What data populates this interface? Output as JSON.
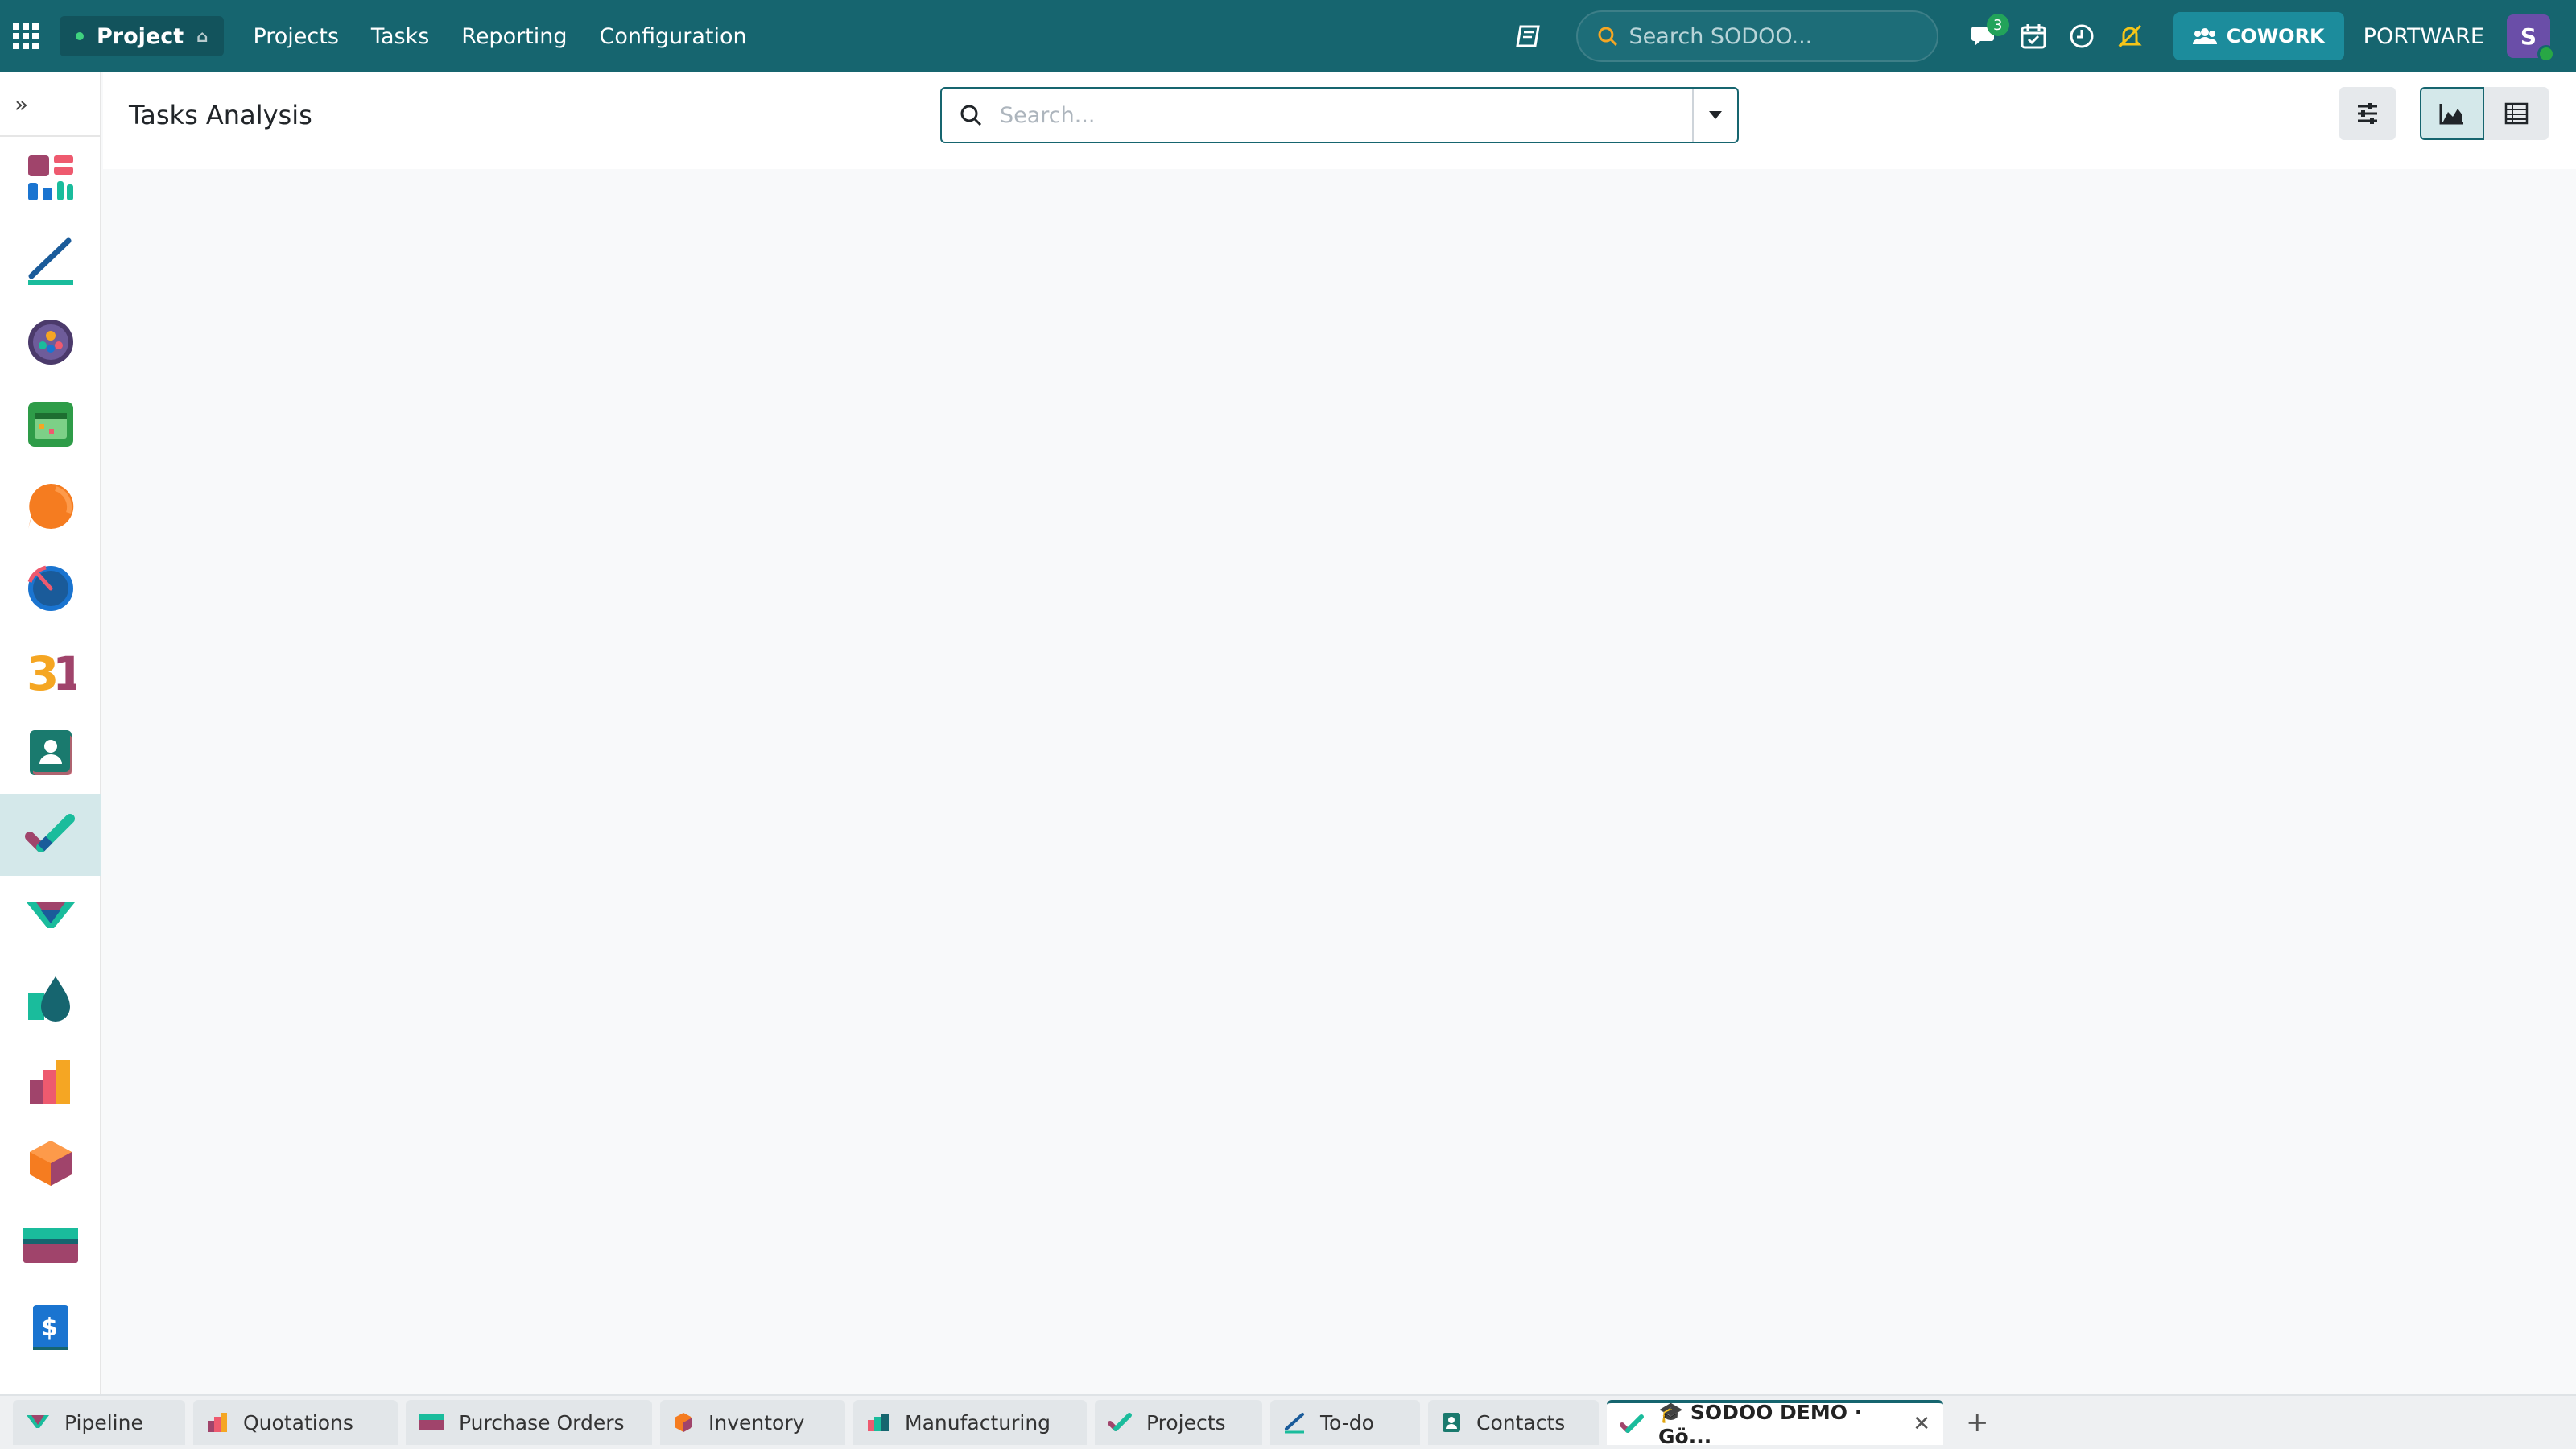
{
  "topbar": {
    "app_name": "Project",
    "menu": [
      "Projects",
      "Tasks",
      "Reporting",
      "Configuration"
    ],
    "search_placeholder": "Search SODOO...",
    "messages_badge": "3",
    "cowork_label": "COWORK",
    "company": "PORTWARE",
    "avatar_initial": "S"
  },
  "control_panel": {
    "title": "Tasks Analysis",
    "search_placeholder": "Search..."
  },
  "sidebar": {
    "toggle": "»",
    "apps": [
      "dashboards",
      "to-do",
      "crm",
      "calendar",
      "discuss",
      "time-off",
      "events",
      "contacts",
      "project",
      "pipeline",
      "accounting",
      "manufacturing",
      "inventory",
      "purchase",
      "invoicing"
    ],
    "active": "project"
  },
  "bottom_tabs": {
    "tabs": [
      {
        "label": "Pipeline",
        "icon": "pipeline-icon"
      },
      {
        "label": "Quotations",
        "icon": "quotations-icon"
      },
      {
        "label": "Purchase Orders",
        "icon": "purchase-icon"
      },
      {
        "label": "Inventory",
        "icon": "inventory-icon"
      },
      {
        "label": "Manufacturing",
        "icon": "manufacturing-icon"
      },
      {
        "label": "Projects",
        "icon": "project-icon"
      },
      {
        "label": "To-do",
        "icon": "todo-icon"
      },
      {
        "label": "Contacts",
        "icon": "contacts-icon"
      }
    ],
    "active_tab": "🎓 SODOO DEMO · Gö...",
    "close": "✕",
    "add": "+"
  },
  "colors": {
    "brand": "#16656f",
    "background": "#f8f9fa"
  }
}
